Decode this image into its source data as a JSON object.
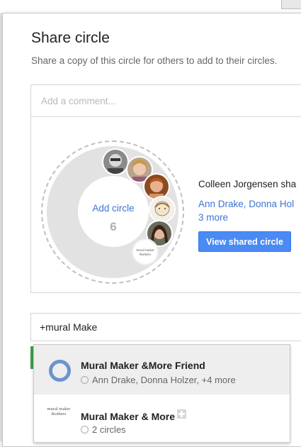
{
  "dialog": {
    "title": "Share circle",
    "subtitle": "Share a copy of this circle for others to add to their circles."
  },
  "comment": {
    "placeholder": "Add a comment..."
  },
  "circle_preview": {
    "add_circle_label": "Add circle",
    "count": "6",
    "avatars": [
      "avatar-1",
      "avatar-2",
      "avatar-3",
      "avatar-4",
      "avatar-5",
      "avatar-6"
    ],
    "logo_text": "mural maker &others"
  },
  "share_info": {
    "sharer_text": "Colleen Jorgensen sha",
    "names_text": "Ann Drake, Donna Hol",
    "more_text": "3 more",
    "view_button_label": "View shared circle"
  },
  "recipient_field": {
    "value": "+mural Make"
  },
  "dropdown": {
    "items": [
      {
        "title": "Mural Maker &More Friend",
        "subtitle": "Ann Drake, Donna Holzer, +4 more",
        "icon": "circle-icon",
        "highlighted": true
      },
      {
        "title": "Mural Maker & More",
        "subtitle": "2 circles",
        "icon": "page-logo",
        "logo_text": "mural maker &others",
        "highlighted": false
      }
    ]
  },
  "colors": {
    "accent_blue": "#4a8af4",
    "link_blue": "#3b73d3",
    "highlight_bg": "#eeeeee",
    "green": "#3d9e46"
  }
}
